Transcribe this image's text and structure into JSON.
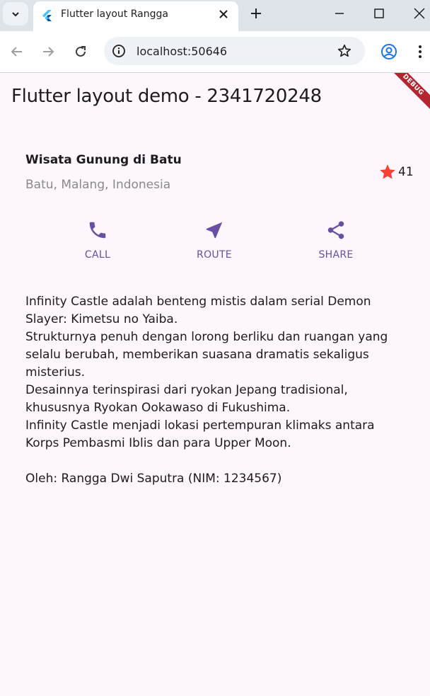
{
  "browser": {
    "tab_title": "Flutter layout Rangga",
    "url": "localhost:50646"
  },
  "app": {
    "title": "Flutter layout demo - 2341720248",
    "debug_banner": "DEBUG"
  },
  "place": {
    "name": "Wisata Gunung di Batu",
    "location": "Batu, Malang, Indonesia",
    "rating_count": "41"
  },
  "actions": [
    {
      "label": "CALL",
      "icon": "phone-icon"
    },
    {
      "label": "ROUTE",
      "icon": "near-me-icon"
    },
    {
      "label": "SHARE",
      "icon": "share-icon"
    }
  ],
  "description": "Infinity Castle adalah benteng mistis dalam serial Demon Slayer: Kimetsu no Yaiba.\nStrukturnya penuh dengan lorong berliku dan ruangan yang selalu berubah, memberikan suasana dramatis sekaligus misterius.\nDesainnya terinspirasi dari ryokan Jepang tradisional, khususnya Ryokan Ookawaso di Fukushima.\nInfinity Castle menjadi lokasi pertempuran klimaks antara Korps Pembasmi Iblis dan para Upper Moon.\n\nOleh: Rangga Dwi Saputra (NIM: 1234567)",
  "colors": {
    "primary": "#6750a4",
    "star": "#f44336",
    "background": "#fdf7fd",
    "debug_banner": "#b3262d"
  }
}
